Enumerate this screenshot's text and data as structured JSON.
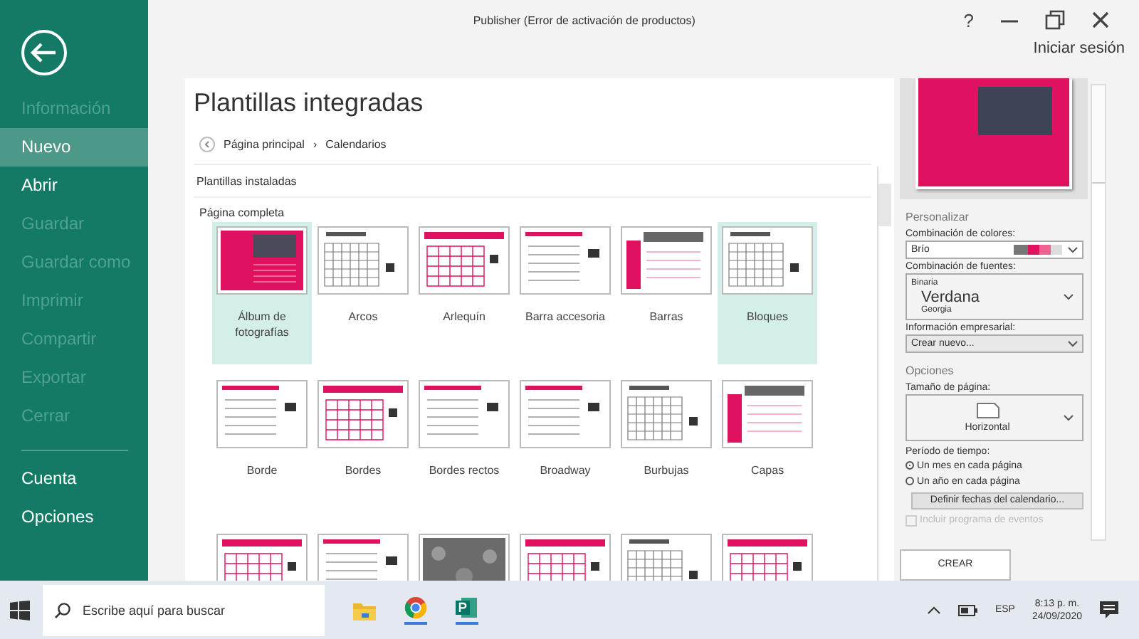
{
  "window": {
    "title": "Publisher (Error de activación de productos)",
    "help": "?",
    "sign_in": "Iniciar sesión"
  },
  "sidebar": {
    "items": [
      {
        "label": "Información",
        "disabled": true,
        "selected": false
      },
      {
        "label": "Nuevo",
        "disabled": false,
        "selected": true
      },
      {
        "label": "Abrir",
        "disabled": false,
        "selected": false
      },
      {
        "label": "Guardar",
        "disabled": true,
        "selected": false
      },
      {
        "label": "Guardar como",
        "disabled": true,
        "selected": false
      },
      {
        "label": "Imprimir",
        "disabled": true,
        "selected": false
      },
      {
        "label": "Compartir",
        "disabled": true,
        "selected": false
      },
      {
        "label": "Exportar",
        "disabled": true,
        "selected": false
      },
      {
        "label": "Cerrar",
        "disabled": true,
        "selected": false
      }
    ],
    "footer_items": [
      {
        "label": "Cuenta",
        "disabled": false,
        "selected": false
      },
      {
        "label": "Opciones",
        "disabled": false,
        "selected": false
      }
    ]
  },
  "gallery": {
    "title": "Plantillas integradas",
    "breadcrumb": [
      "Página principal",
      "Calendarios"
    ],
    "separator": "›",
    "section": "Plantillas instaladas",
    "group": "Página completa",
    "templates": [
      {
        "label": "Álbum de fotografías",
        "kind": "photo",
        "selected": true
      },
      {
        "label": "Arcos",
        "kind": "grid",
        "selected": false
      },
      {
        "label": "Arlequín",
        "kind": "pinkgrid",
        "selected": false
      },
      {
        "label": "Barra accesoria",
        "kind": "lines",
        "selected": false
      },
      {
        "label": "Barras",
        "kind": "sidebar",
        "selected": false
      },
      {
        "label": "Bloques",
        "kind": "grid",
        "selected": true
      },
      {
        "label": "Borde",
        "kind": "lines",
        "selected": false
      },
      {
        "label": "Bordes",
        "kind": "pinkgrid",
        "selected": false
      },
      {
        "label": "Bordes rectos",
        "kind": "lines",
        "selected": false
      },
      {
        "label": "Broadway",
        "kind": "lines",
        "selected": false
      },
      {
        "label": "Burbujas",
        "kind": "grid",
        "selected": false
      },
      {
        "label": "Capas",
        "kind": "sidebar",
        "selected": false
      },
      {
        "kind": "pinkgrid",
        "selected": false
      },
      {
        "kind": "lines",
        "selected": false
      },
      {
        "kind": "dark",
        "selected": false
      },
      {
        "kind": "pinkgrid",
        "selected": false
      },
      {
        "kind": "grid",
        "selected": false
      },
      {
        "kind": "pinkgrid",
        "selected": false
      }
    ]
  },
  "customize": {
    "heading": "Personalizar",
    "color_label": "Combinación de colores:",
    "color_value": "Brío",
    "font_label": "Combinación de fuentes:",
    "fonts": [
      "Binaria",
      "Verdana",
      "Georgia"
    ],
    "business_label": "Información empresarial:",
    "business_value": "Crear nuevo...",
    "options_heading": "Opciones",
    "size_label": "Tamaño de página:",
    "size_value": "Horizontal",
    "period_label": "Período de tiempo:",
    "periods": [
      {
        "label": "Un mes en cada página",
        "selected": true
      },
      {
        "label": "Un año en cada página",
        "selected": false
      }
    ],
    "dates_button": "Definir fechas del calendario...",
    "events": {
      "label": "Incluir programa de eventos",
      "checked": false,
      "disabled": true
    },
    "create_button": "CREAR"
  },
  "taskbar": {
    "search_placeholder": "Escribe aquí para buscar",
    "language": "ESP",
    "time": "8:13 p. m.",
    "date": "24/09/2020"
  }
}
